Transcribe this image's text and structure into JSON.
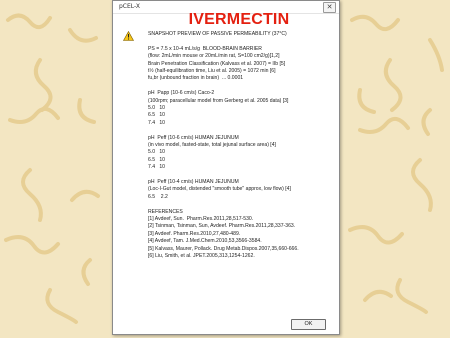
{
  "window": {
    "title": "pCEL-X",
    "close_label": "✕"
  },
  "heading": "IVERMECTIN",
  "icon": "warning-icon",
  "lines": [
    "SNAPSHOT PREVIEW OF PASSIVE PERMEABILITY (37°C)",
    "",
    "PS = 7.5 x 10-4 mL/s/g  BLOOD-BRAIN BARRIER",
    "(flow: 2mL/min mouse or 20mL/min rat, S=100 cm2/g)[1,2]",
    "Brain Penetration Classification (Kalvass et al. 2007) = IIb [5]",
    "t½ (half-equilibration time, Liu et al. 2005) = 1072 min [6]",
    "fu,br (unbound fraction in brain)  ... 0.0001",
    "",
    "pH  Papp (10-6 cm/s) Caco-2",
    "(100rpm; paracellular model from Gerberg et al. 2005 data) [3]",
    "5.0   10",
    "6.5   10",
    "7.4   10",
    "",
    "pH  Peff (10-6 cm/s) HUMAN JEJUNUM",
    "(in vivo model, fasted-state, total jejunal surface area) [4]",
    "5.0   10",
    "6.5   10",
    "7.4   10",
    "",
    "pH  Peff (10-4 cm/s) HUMAN JEJUNUM",
    "(Loc-I-Gut model, distended \"smooth tube\" approx, low flow) [4]",
    "6.5    2.2",
    "",
    "REFERENCES",
    "[1] Avdeef, Sun.  Pharm.Res.2011,28,517-530.",
    "[2] Tsinman, Tsinman, Sun, Avdeef. Pharm.Res.2011,28,337-363.",
    "[3] Avdeef. Pharm.Res.2010,27,480-489.",
    "[4] Avdeef, Tam. J.Med.Chem.2010,53,3566-3584.",
    "[5] Kalvass, Maurer, Pollack. Drug Metab.Dispos.2007,35,660-666.",
    "[6] Liu, Smith, et al. JPET.2005,313,1254-1262."
  ],
  "ok_button": {
    "label": "OK"
  },
  "colors": {
    "heading": "#e42010",
    "background": "#f3e6c2",
    "pattern": "#e7cf95",
    "warning": "#f5c518"
  }
}
